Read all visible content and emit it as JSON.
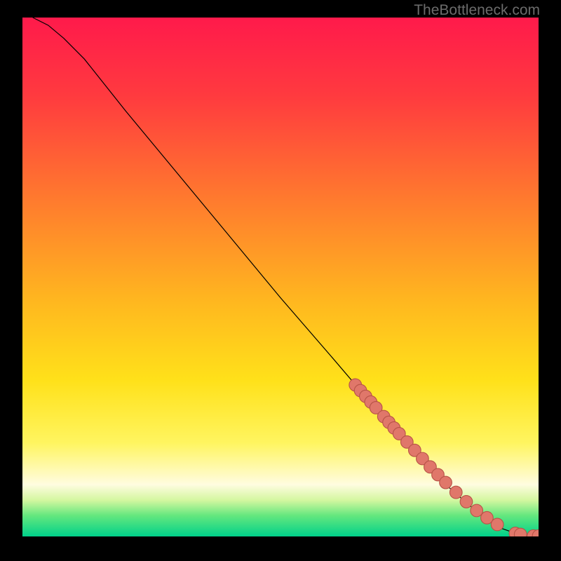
{
  "watermark": "TheBottleneck.com",
  "palette": {
    "gradient_stops": [
      {
        "offset": 0.0,
        "color": "#ff1a4b"
      },
      {
        "offset": 0.15,
        "color": "#ff3a3f"
      },
      {
        "offset": 0.35,
        "color": "#ff7a2e"
      },
      {
        "offset": 0.55,
        "color": "#ffb81f"
      },
      {
        "offset": 0.7,
        "color": "#ffe11a"
      },
      {
        "offset": 0.82,
        "color": "#fff560"
      },
      {
        "offset": 0.9,
        "color": "#fffce0"
      },
      {
        "offset": 0.93,
        "color": "#d4f7a0"
      },
      {
        "offset": 0.96,
        "color": "#63e77e"
      },
      {
        "offset": 1.0,
        "color": "#00d18a"
      }
    ],
    "line_color": "#000000",
    "marker_fill": "#e0776a",
    "marker_stroke": "#b75347"
  },
  "chart_data": {
    "type": "line",
    "title": "",
    "xlabel": "",
    "ylabel": "",
    "xlim": [
      0,
      100
    ],
    "ylim": [
      0,
      100
    ],
    "series": [
      {
        "name": "curve",
        "x": [
          2,
          5,
          8,
          12,
          20,
          30,
          40,
          50,
          60,
          66,
          70,
          74,
          78,
          82,
          86,
          89,
          91,
          93,
          95,
          97,
          98.5,
          99.5
        ],
        "y": [
          100,
          98.5,
          96,
          92,
          82,
          70,
          58,
          46,
          34.5,
          27.5,
          23,
          18.5,
          14,
          10,
          6.5,
          4,
          2.5,
          1.5,
          0.8,
          0.3,
          0.1,
          0.05
        ]
      }
    ],
    "markers": {
      "name": "points",
      "x": [
        64.5,
        65.5,
        66.5,
        67.5,
        68.5,
        70.0,
        71.0,
        72.0,
        73.0,
        74.5,
        76.0,
        77.5,
        79.0,
        80.5,
        82.0,
        84.0,
        86.0,
        88.0,
        90.0,
        92.0,
        95.5,
        96.5,
        99.0,
        100.0
      ],
      "y": [
        29.2,
        28.1,
        27.0,
        25.9,
        24.8,
        23.1,
        22.0,
        20.9,
        19.8,
        18.2,
        16.6,
        15.0,
        13.4,
        11.9,
        10.4,
        8.5,
        6.7,
        5.0,
        3.6,
        2.3,
        0.6,
        0.4,
        0.1,
        0.1
      ]
    },
    "marker_radius": 1.2
  }
}
